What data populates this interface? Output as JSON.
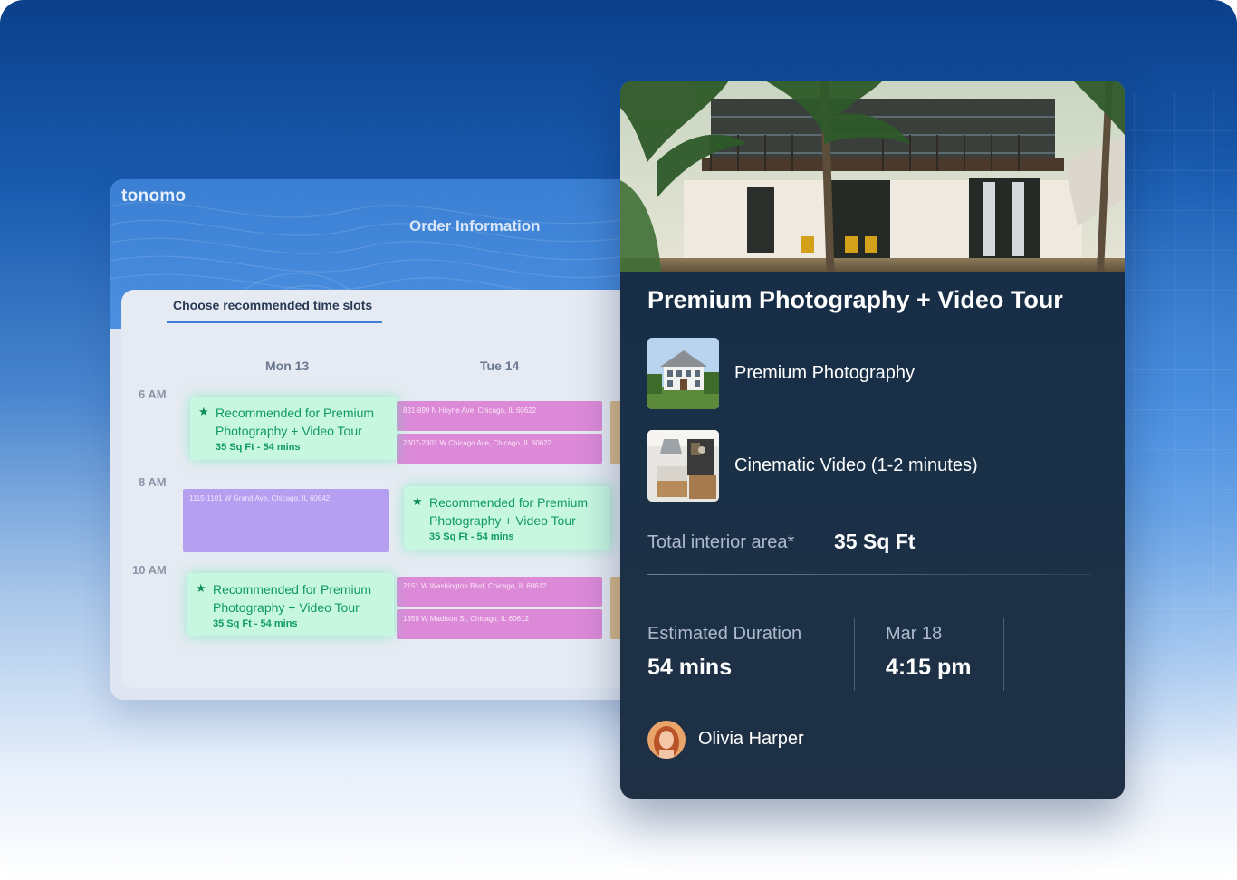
{
  "brand": {
    "logo": "tonomo"
  },
  "scheduler": {
    "header_title": "Order Information",
    "tab_label": "Choose recommended time slots",
    "days": [
      "Mon 13",
      "Tue 14"
    ],
    "times": [
      "6 AM",
      "8 AM",
      "10 AM"
    ],
    "recommended": {
      "title": "Recommended for Premium Photography + Video Tour",
      "line1": "Recommended for Premium",
      "line2": "Photography + Video Tour",
      "sub": "35 Sq Ft - 54 mins"
    },
    "booked_slots": [
      "831-899 N Hoyne Ave, Chicago, IL 60622",
      "2307-2301 W Chicago Ave, Chicago, IL 60622",
      "1115-1101 W Grand Ave, Chicago, IL 60642",
      "2151 W Washington Blvd, Chicago, IL 60612",
      "1859 W Madison St, Chicago, IL 60612"
    ]
  },
  "order": {
    "title": "Premium Photography + Video Tour",
    "services": [
      {
        "name": "Premium Photography",
        "icon": "house-photo"
      },
      {
        "name": "Cinematic Video (1-2 minutes)",
        "icon": "kitchen-photo"
      }
    ],
    "area_label": "Total interior area*",
    "area_value": "35 Sq Ft",
    "duration_label": "Estimated Duration",
    "duration_value": "54 mins",
    "date_label": "Mar 18",
    "time_value": "4:15 pm",
    "photographer": "Olivia Harper"
  },
  "colors": {
    "recommended_bg": "#c8f7e1",
    "recommended_text": "#0f9a64",
    "booked_pink": "#dc8ad8",
    "booked_purple": "#b59ff0",
    "card_bg": "#1a3047",
    "accent_blue": "#3a7fd3"
  }
}
